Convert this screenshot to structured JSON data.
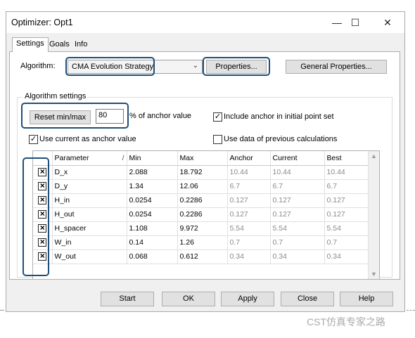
{
  "window": {
    "title": "Optimizer: Opt1",
    "minimize": "—",
    "maximize": "☐",
    "close": "✕"
  },
  "tabs": [
    {
      "label": "Settings"
    },
    {
      "label": "Goals"
    },
    {
      "label": "Info"
    }
  ],
  "algorithm": {
    "label": "Algorithm:",
    "selected": "CMA Evolution Strategy",
    "properties_label": "Properties...",
    "general_properties_label": "General Properties..."
  },
  "settings": {
    "group_title": "Algorithm settings",
    "reset_label": "Reset min/max",
    "anchor_value": "80",
    "anchor_suffix": "% of anchor value",
    "include_anchor_label": "Include anchor in initial point set",
    "include_anchor_checked": true,
    "use_current_label": "Use current as anchor value",
    "use_current_checked": true,
    "use_previous_label": "Use data of previous calculations",
    "use_previous_checked": false
  },
  "table": {
    "columns": [
      "Parameter",
      "Min",
      "Max",
      "Anchor",
      "Current",
      "Best"
    ],
    "sort_indicator": "/",
    "rows": [
      {
        "name": "D_x",
        "min": "2.088",
        "max": "18.792",
        "anchor": "10.44",
        "current": "10.44",
        "best": "10.44"
      },
      {
        "name": "D_y",
        "min": "1.34",
        "max": "12.06",
        "anchor": "6.7",
        "current": "6.7",
        "best": "6.7"
      },
      {
        "name": "H_in",
        "min": "0.0254",
        "max": "0.2286",
        "anchor": "0.127",
        "current": "0.127",
        "best": "0.127"
      },
      {
        "name": "H_out",
        "min": "0.0254",
        "max": "0.2286",
        "anchor": "0.127",
        "current": "0.127",
        "best": "0.127"
      },
      {
        "name": "H_spacer",
        "min": "1.108",
        "max": "9.972",
        "anchor": "5.54",
        "current": "5.54",
        "best": "5.54"
      },
      {
        "name": "W_in",
        "min": "0.14",
        "max": "1.26",
        "anchor": "0.7",
        "current": "0.7",
        "best": "0.7"
      },
      {
        "name": "W_out",
        "min": "0.068",
        "max": "0.612",
        "anchor": "0.34",
        "current": "0.34",
        "best": "0.34"
      }
    ]
  },
  "buttons": {
    "start": "Start",
    "ok": "OK",
    "apply": "Apply",
    "close": "Close",
    "help": "Help"
  },
  "watermark": "CST仿真专家之路",
  "colors": {
    "highlight": "#1f4e79",
    "dialog_bg": "#f0f0f0",
    "readonly_text": "#8a8a8a"
  }
}
